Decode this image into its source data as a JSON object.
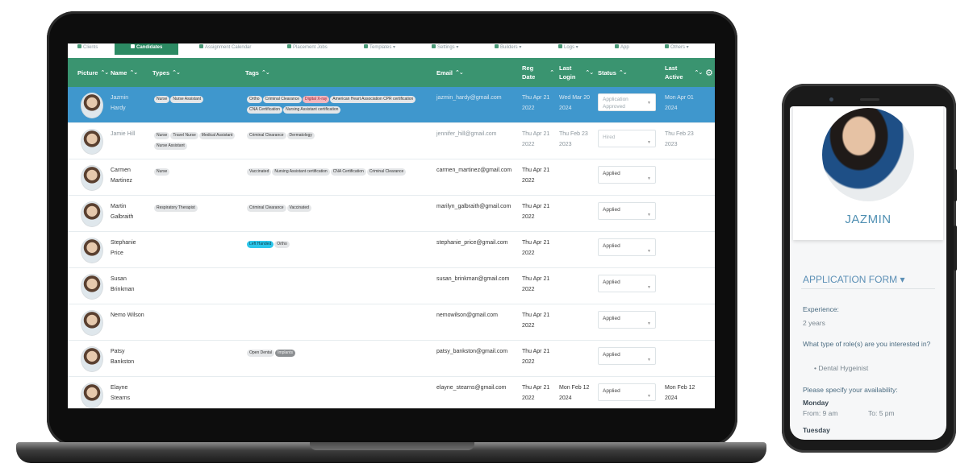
{
  "nav": {
    "items": [
      {
        "label": "Clients"
      },
      {
        "label": "Candidates"
      },
      {
        "label": "Assignment Calendar"
      },
      {
        "label": "Placement Jobs"
      },
      {
        "label": "Templates ▾"
      },
      {
        "label": "Settings ▾"
      },
      {
        "label": "Builders ▾"
      },
      {
        "label": "Logs ▾"
      },
      {
        "label": "App"
      },
      {
        "label": "Others ▾"
      }
    ]
  },
  "table": {
    "columns": {
      "picture": "Picture",
      "name": "Name",
      "types": "Types",
      "tags": "Tags",
      "email": "Email",
      "reg_date_1": "Reg",
      "reg_date_2": "Date",
      "last_login_1": "Last",
      "last_login_2": "Login",
      "status": "Status",
      "last_active_1": "Last",
      "last_active_2": "Active"
    },
    "rows": [
      {
        "name1": "Jazmin",
        "name2": "Hardy",
        "types": [
          "Nurse",
          "Nurse Assistant"
        ],
        "tags": [
          {
            "t": "Ortho",
            "s": ""
          },
          {
            "t": "Criminal Clearance",
            "s": ""
          },
          {
            "t": "Digital X-ray",
            "s": "red"
          },
          {
            "t": "American Heart Association CPR certification",
            "s": ""
          },
          {
            "t": "CNA Certification",
            "s": ""
          },
          {
            "t": "Nursing Assistant certification",
            "s": ""
          }
        ],
        "email": "jazmin_hardy@gmail.com",
        "reg1": "Thu Apr 21",
        "reg2": "2022",
        "login1": "Wed Mar 20",
        "login2": "2024",
        "status1": "Application",
        "status2": "Approved",
        "active1": "Mon Apr 01",
        "active2": "2024",
        "selected": true
      },
      {
        "name1": "Jamie Hill",
        "name2": "",
        "types": [
          "Nurse",
          "Travel Nurse",
          "Medical Assistant",
          "Nurse Assistant"
        ],
        "tags": [
          {
            "t": "Criminal Clearance",
            "s": ""
          },
          {
            "t": "Dermatology",
            "s": ""
          }
        ],
        "email": "jennifer_hill@gmail.com",
        "reg1": "Thu Apr 21",
        "reg2": "2022",
        "login1": "Thu Feb 23",
        "login2": "2023",
        "status1": "Hired",
        "status2": "",
        "active1": "Thu Feb 23",
        "active2": "2023",
        "dim": true
      },
      {
        "name1": "Carmen",
        "name2": "Martinez",
        "types": [
          "Nurse"
        ],
        "tags": [
          {
            "t": "Vaccinated",
            "s": ""
          },
          {
            "t": "Nursing Assistant certification",
            "s": ""
          },
          {
            "t": "CNA Certification",
            "s": ""
          },
          {
            "t": "Criminal Clearance",
            "s": ""
          }
        ],
        "email": "carmen_martinez@gmail.com",
        "reg1": "Thu Apr 21",
        "reg2": "2022",
        "login1": "",
        "login2": "",
        "status1": "Applied",
        "status2": "",
        "active1": "",
        "active2": ""
      },
      {
        "name1": "Martin",
        "name2": "Galbraith",
        "types": [
          "Respiratory Therapist"
        ],
        "tags": [
          {
            "t": "Criminal Clearance",
            "s": ""
          },
          {
            "t": "Vaccinated",
            "s": ""
          }
        ],
        "email": "marilyn_galbraith@gmail.com",
        "reg1": "Thu Apr 21",
        "reg2": "2022",
        "login1": "",
        "login2": "",
        "status1": "Applied",
        "status2": "",
        "active1": "",
        "active2": ""
      },
      {
        "name1": "Stephanie",
        "name2": "Price",
        "types": [],
        "tags": [
          {
            "t": "Left Handed",
            "s": "cyan"
          },
          {
            "t": "Ortho",
            "s": ""
          }
        ],
        "email": "stephanie_price@gmail.com",
        "reg1": "Thu Apr 21",
        "reg2": "2022",
        "login1": "",
        "login2": "",
        "status1": "Applied",
        "status2": "",
        "active1": "",
        "active2": ""
      },
      {
        "name1": "Susan",
        "name2": "Brinkman",
        "types": [],
        "tags": [],
        "email": "susan_brinkman@gmail.com",
        "reg1": "Thu Apr 21",
        "reg2": "2022",
        "login1": "",
        "login2": "",
        "status1": "Applied",
        "status2": "",
        "active1": "",
        "active2": ""
      },
      {
        "name1": "Nemo Wilson",
        "name2": "",
        "types": [],
        "tags": [],
        "email": "nemowilson@gmail.com",
        "reg1": "Thu Apr 21",
        "reg2": "2022",
        "login1": "",
        "login2": "",
        "status1": "Applied",
        "status2": "",
        "active1": "",
        "active2": ""
      },
      {
        "name1": "Patsy",
        "name2": "Bankston",
        "types": [],
        "tags": [
          {
            "t": "Open Dental",
            "s": ""
          },
          {
            "t": "Implants",
            "s": "grey"
          }
        ],
        "email": "patsy_bankston@gmail.com",
        "reg1": "Thu Apr 21",
        "reg2": "2022",
        "login1": "",
        "login2": "",
        "status1": "Applied",
        "status2": "",
        "active1": "",
        "active2": ""
      },
      {
        "name1": "Elayne",
        "name2": "Stearns",
        "types": [],
        "tags": [],
        "email": "elayne_stearns@gmail.com",
        "reg1": "Thu Apr 21",
        "reg2": "2022",
        "login1": "Mon Feb 12",
        "login2": "2024",
        "status1": "Applied",
        "status2": "",
        "active1": "Mon Feb 12",
        "active2": "2024"
      }
    ]
  },
  "phone": {
    "profile_name": "JAZMIN",
    "form_title": "APPLICATION FORM ▾",
    "q_experience": "Experience:",
    "a_experience": "2 years",
    "q_role": "What type of role(s) are you interested in?",
    "a_role": "• Dental Hygeinist",
    "q_availability": "Please specify your availability:",
    "day1": "Monday",
    "day1_from": "From: 9 am",
    "day1_to": "To: 5 pm",
    "day2": "Tuesday"
  },
  "colors": {
    "accent": "#3a9470",
    "selected_row": "#3f97cd",
    "phone_accent": "#4f8fb2"
  }
}
